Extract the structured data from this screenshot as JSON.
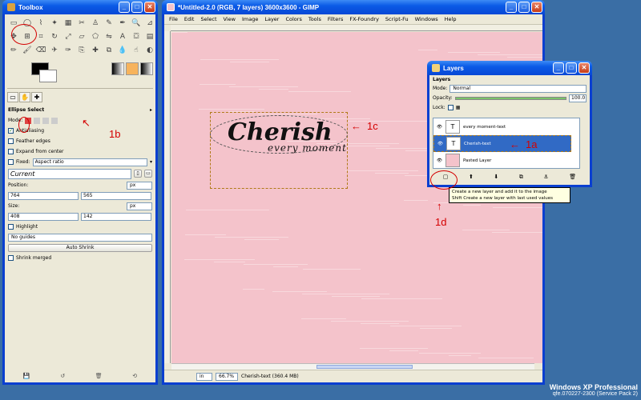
{
  "toolbox": {
    "title": "Toolbox",
    "tool_options_title": "Ellipse Select",
    "mode_label": "Mode:",
    "antialiasing": "Antialiasing",
    "feather": "Feather edges",
    "expand": "Expand from center",
    "fixed": "Fixed:",
    "fixed_value": "Aspect ratio",
    "current": "Current",
    "position_label": "Position:",
    "pos_x": "764",
    "pos_y": "565",
    "size_label": "Size:",
    "size_w": "408",
    "size_h": "142",
    "unit": "px",
    "highlight": "Highlight",
    "guides": "No guides",
    "auto_shrink": "Auto Shrink",
    "shrink_merged": "Shrink merged"
  },
  "image_window": {
    "title": "*Untitled-2.0 (RGB, 7 layers) 3600x3600 - GIMP",
    "menu": [
      "File",
      "Edit",
      "Select",
      "View",
      "Image",
      "Layer",
      "Colors",
      "Tools",
      "Filters",
      "FX-Foundry",
      "Script-Fu",
      "Windows",
      "Help"
    ],
    "unit": "in",
    "zoom": "66.7%",
    "status": "Cherish-text (360.4 MB)",
    "art_main": "Cherish",
    "art_sub": "every moment"
  },
  "layers": {
    "title": "Layers",
    "heading": "Layers",
    "mode_label": "Mode:",
    "mode_value": "Normal",
    "opacity_label": "Opacity:",
    "opacity_value": "100.0",
    "lock_label": "Lock:",
    "items": [
      {
        "name": "every moment-text"
      },
      {
        "name": "Cherish-text"
      },
      {
        "name": "Pasted Layer"
      }
    ],
    "tooltip_line1": "Create a new layer and add it to the image",
    "tooltip_line2": "Shift  Create a new layer with last used values"
  },
  "annotations": {
    "a1": "1a",
    "b1": "1b",
    "c1": "1c",
    "d1": "1d"
  },
  "os": {
    "line1": "Windows XP Professional",
    "line2": "qfe.070227-2300 (Service Pack 2)"
  },
  "colors": {
    "canvas": "#f4c3cb",
    "annotation": "#d40000",
    "selection": "#316ac5"
  }
}
